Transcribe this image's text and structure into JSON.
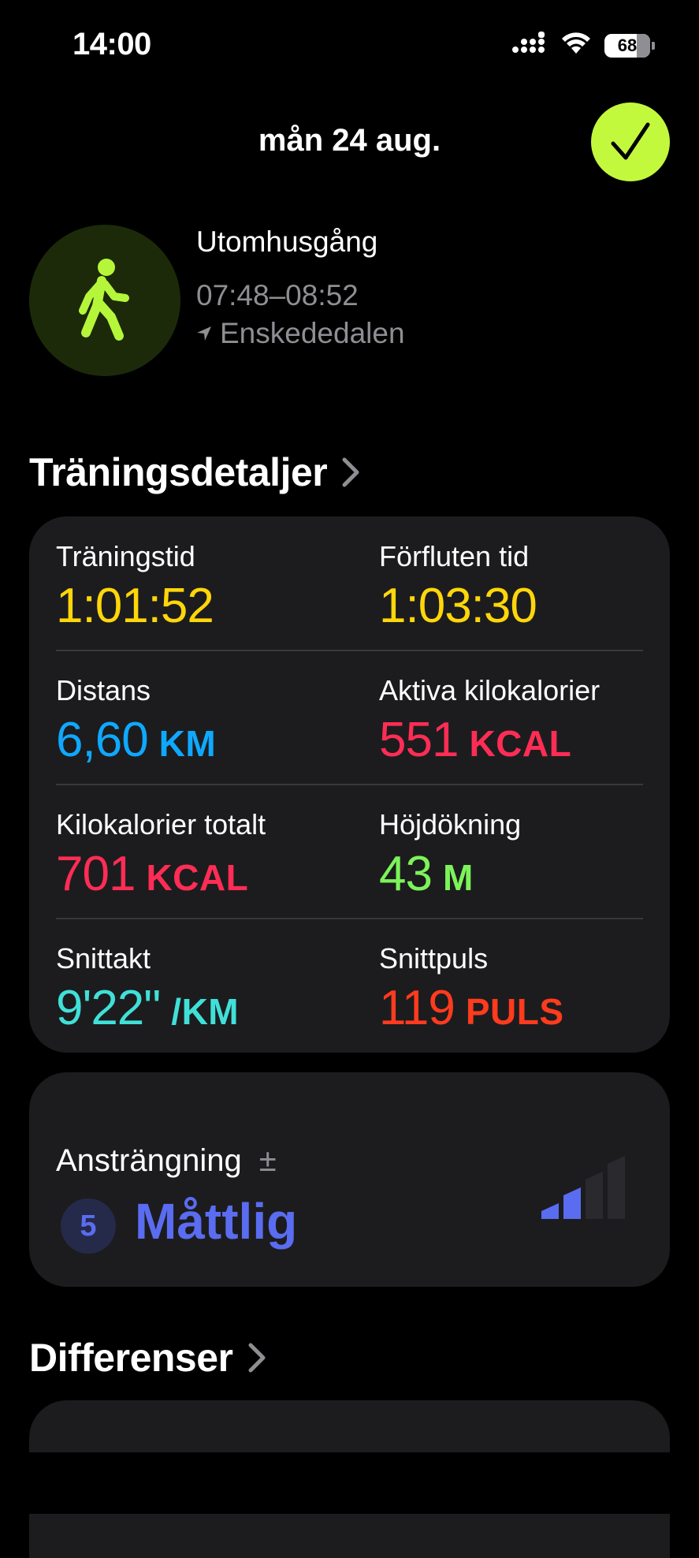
{
  "status_bar": {
    "time": "14:00",
    "battery": "68",
    "icons": [
      "cellular-signal-icon",
      "wifi-icon",
      "battery-icon"
    ]
  },
  "header": {
    "date": "mån 24 aug.",
    "done_icon": "checkmark-icon"
  },
  "workout": {
    "icon": "walking-figure-icon",
    "name": "Utomhusgång",
    "time_range": "07:48–08:52",
    "location": "Enskededalen"
  },
  "details": {
    "title": "Träningsdetaljer",
    "metrics": [
      {
        "label": "Träningstid",
        "value": "1:01:52",
        "unit": "",
        "color": "#ffd60a"
      },
      {
        "label": "Förfluten tid",
        "value": "1:03:30",
        "unit": "",
        "color": "#ffd60a"
      },
      {
        "label": "Distans",
        "value": "6,60",
        "unit": "KM",
        "color": "#0fa8ff"
      },
      {
        "label": "Aktiva kilokalorier",
        "value": "551",
        "unit": "KCAL",
        "color": "#ff2d55"
      },
      {
        "label": "Kilokalorier totalt",
        "value": "701",
        "unit": "KCAL",
        "color": "#ff2d55"
      },
      {
        "label": "Höjdökning",
        "value": "43",
        "unit": "M",
        "color": "#7cf35a"
      },
      {
        "label": "Snittakt",
        "value": "9'22\"",
        "unit": "/KM",
        "color": "#40e0d8"
      },
      {
        "label": "Snittpuls",
        "value": "119",
        "unit": "PULS",
        "color": "#ff3b1e"
      }
    ]
  },
  "effort": {
    "label": "Ansträngning",
    "edit_symbol": "±",
    "level": "5",
    "value": "Måttlig",
    "bars_filled": 2,
    "bars_total": 4,
    "color": "#5a6cf0"
  },
  "differences": {
    "title": "Differenser"
  }
}
